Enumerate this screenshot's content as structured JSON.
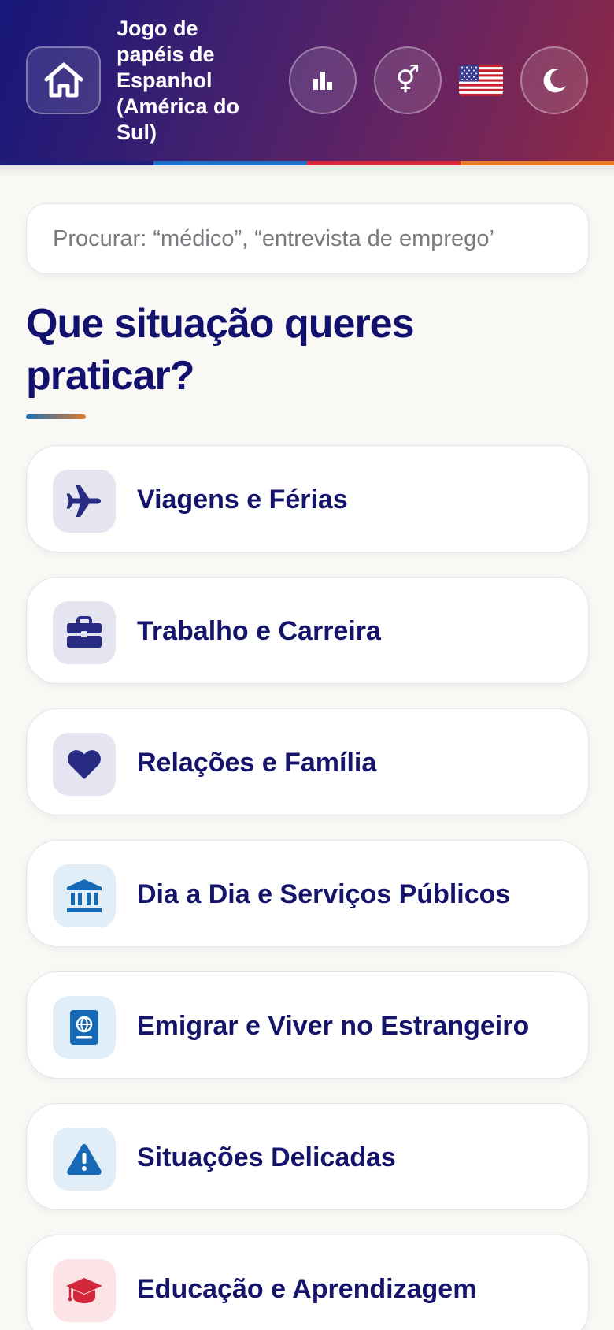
{
  "header": {
    "title": "Jogo de papéis de Espanhol (América do Sul)",
    "title_lines": [
      "Jogo de",
      "papéis de",
      "Espanhol",
      "(América do",
      "Sul)"
    ],
    "buttons": [
      {
        "icon": "home-icon"
      },
      {
        "icon": "bar-chart-icon"
      },
      {
        "icon": "gender-icon",
        "glyph": "⚥"
      },
      {
        "icon": "us-flag-icon"
      },
      {
        "icon": "moon-icon"
      }
    ],
    "stripe_colors": [
      "#1f1f7a",
      "#1e73c8",
      "#d9283a",
      "#e67a24"
    ]
  },
  "search": {
    "placeholder": "Procurar: “médico”, “entrevista de emprego’",
    "value": ""
  },
  "main": {
    "heading_lines": [
      "Que situação queres",
      "praticar?"
    ]
  },
  "categories": [
    {
      "label": "Viagens e Férias",
      "icon": "airplane-icon",
      "icon_bg": "#e5e5f1",
      "icon_color": "#282b82"
    },
    {
      "label": "Trabalho e Carreira",
      "icon": "briefcase-icon",
      "icon_bg": "#e5e5f1",
      "icon_color": "#282b82"
    },
    {
      "label": "Relações e Família",
      "icon": "heart-icon",
      "icon_bg": "#e5e5f1",
      "icon_color": "#282b82"
    },
    {
      "label": "Dia a Dia e Serviços Públicos",
      "icon": "bank-icon",
      "icon_bg": "#e1edf7",
      "icon_color": "#1569b5"
    },
    {
      "label": "Emigrar e Viver no Estrangeiro",
      "icon": "passport-icon",
      "icon_bg": "#e1edf7",
      "icon_color": "#1569b5"
    },
    {
      "label": "Situações Delicadas",
      "icon": "warning-icon",
      "icon_bg": "#e1edf7",
      "icon_color": "#1569b5"
    },
    {
      "label": "Educação e Aprendizagem",
      "icon": "graduation-cap-icon",
      "icon_bg": "#fbe3e6",
      "icon_color": "#d3283c"
    }
  ]
}
